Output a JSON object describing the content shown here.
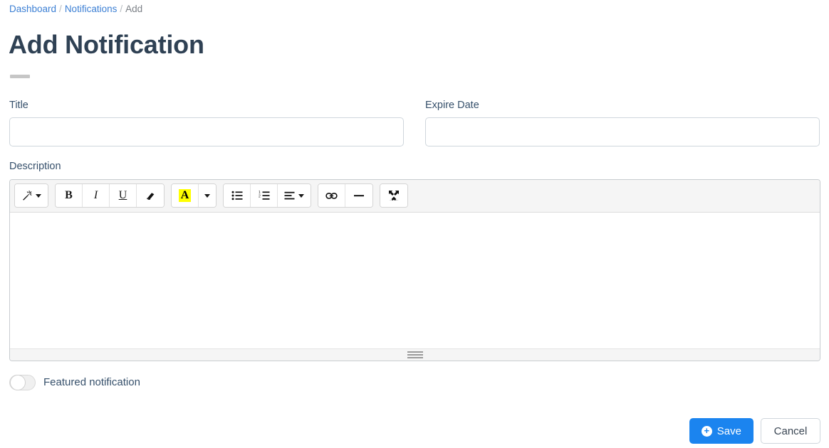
{
  "breadcrumb": {
    "items": [
      {
        "label": "Dashboard",
        "link": true
      },
      {
        "label": "Notifications",
        "link": true
      },
      {
        "label": "Add",
        "link": false
      }
    ],
    "separator": "/"
  },
  "page": {
    "title": "Add Notification"
  },
  "form": {
    "title_field": {
      "label": "Title",
      "value": "",
      "placeholder": ""
    },
    "expire_field": {
      "label": "Expire Date",
      "value": "",
      "placeholder": ""
    },
    "description_field": {
      "label": "Description",
      "value": ""
    }
  },
  "editor": {
    "toolbar": [
      {
        "name": "style-dropdown",
        "icon": "magic-wand-icon",
        "label": "",
        "caret": true
      },
      {
        "name": "bold",
        "icon": "bold-icon",
        "label": "B"
      },
      {
        "name": "italic",
        "icon": "italic-icon",
        "label": "I"
      },
      {
        "name": "underline",
        "icon": "underline-icon",
        "label": "U"
      },
      {
        "name": "remove-format",
        "icon": "eraser-icon",
        "label": ""
      },
      {
        "name": "font-color",
        "icon": "font-color-icon",
        "label": "A",
        "highlight": "#ffff00",
        "caret": true
      },
      {
        "name": "unordered-list",
        "icon": "bullet-list-icon",
        "label": ""
      },
      {
        "name": "ordered-list",
        "icon": "numbered-list-icon",
        "label": ""
      },
      {
        "name": "paragraph-align",
        "icon": "align-left-icon",
        "label": "",
        "caret": true
      },
      {
        "name": "insert-link",
        "icon": "link-icon",
        "label": ""
      },
      {
        "name": "horizontal-rule",
        "icon": "horizontal-rule-icon",
        "label": ""
      },
      {
        "name": "fullscreen",
        "icon": "expand-arrows-icon",
        "label": ""
      }
    ],
    "content": "",
    "resize_handle": "resize-grip-icon"
  },
  "featured_toggle": {
    "label": "Featured notification",
    "checked": false
  },
  "actions": {
    "save_label": "Save",
    "save_icon": "plus-circle-icon",
    "cancel_label": "Cancel"
  },
  "colors": {
    "link": "#3b7fd4",
    "heading": "#2f4154",
    "primary": "#1b84ef",
    "label": "#36506b",
    "toolbar_bg": "#f5f5f5",
    "highlight": "#ffff00"
  }
}
